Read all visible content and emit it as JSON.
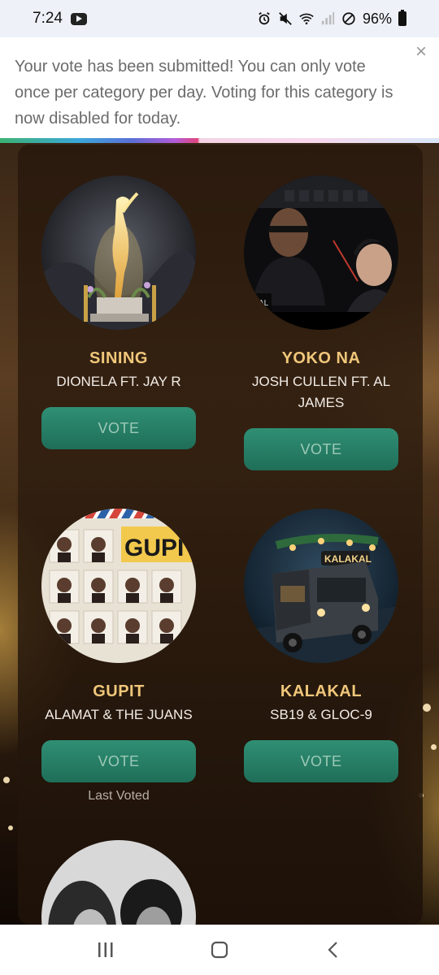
{
  "status": {
    "time": "7:24",
    "battery": "96%"
  },
  "notice": {
    "message": "Your vote has been submitted! You can only vote once per category per day. Voting for this category is now disabled for today.",
    "close_label": "×"
  },
  "nominees": [
    {
      "title": "SINING",
      "artist": "DIONELA FT. JAY R",
      "vote_label": "VOTE"
    },
    {
      "title": "YOKO NA",
      "artist": "JOSH CULLEN FT. AL JAMES",
      "vote_label": "VOTE"
    },
    {
      "title": "GUPIT",
      "artist": "ALAMAT & THE JUANS",
      "vote_label": "VOTE",
      "note": "Last Voted",
      "cover_text": "GUPIT"
    },
    {
      "title": "KALAKAL",
      "artist": "SB19 & GLOC-9",
      "vote_label": "VOTE",
      "cover_text": "KALAKAL"
    }
  ],
  "colors": {
    "title_gold": "#f0c77a",
    "vote_green": "#2f8f74",
    "vote_text": "#9cc9b7"
  }
}
